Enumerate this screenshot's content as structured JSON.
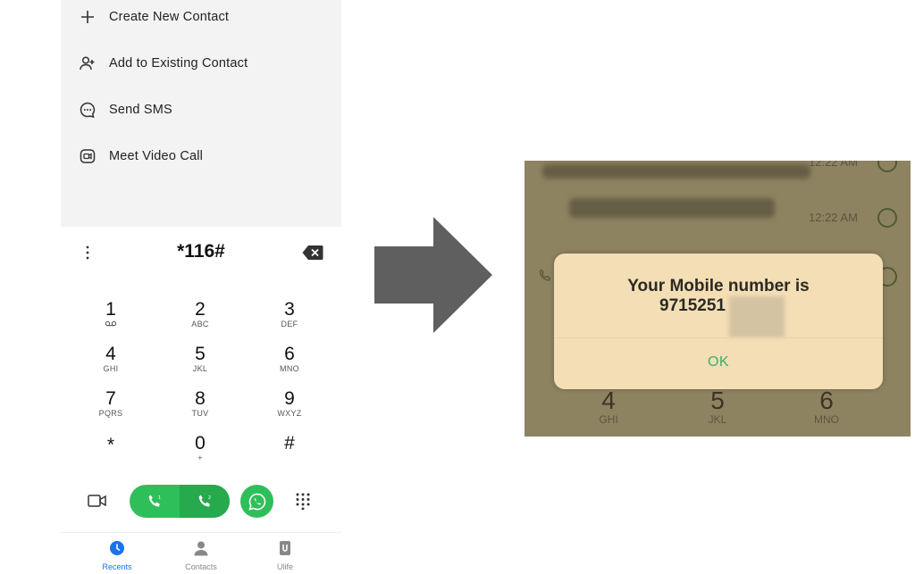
{
  "menu": {
    "items": [
      {
        "label": "Create New Contact",
        "icon": "plus-icon"
      },
      {
        "label": "Add to Existing Contact",
        "icon": "add-person-icon"
      },
      {
        "label": "Send SMS",
        "icon": "sms-icon"
      },
      {
        "label": "Meet Video Call",
        "icon": "meet-video-icon"
      }
    ]
  },
  "dialer": {
    "input_value": "*116#",
    "keys": [
      {
        "digit": "1",
        "letters": "voicemail-icon"
      },
      {
        "digit": "2",
        "letters": "ABC"
      },
      {
        "digit": "3",
        "letters": "DEF"
      },
      {
        "digit": "4",
        "letters": "GHI"
      },
      {
        "digit": "5",
        "letters": "JKL"
      },
      {
        "digit": "6",
        "letters": "MNO"
      },
      {
        "digit": "7",
        "letters": "PQRS"
      },
      {
        "digit": "8",
        "letters": "TUV"
      },
      {
        "digit": "9",
        "letters": "WXYZ"
      },
      {
        "digit": "*",
        "letters": ""
      },
      {
        "digit": "0",
        "letters": "+"
      },
      {
        "digit": "#",
        "letters": ""
      }
    ],
    "sim1_label": "1",
    "sim2_label": "2"
  },
  "tabs": [
    {
      "label": "Recents",
      "active": true
    },
    {
      "label": "Contacts",
      "active": false
    },
    {
      "label": "Ulife",
      "active": false
    }
  ],
  "result_screen": {
    "message": "Your Mobile number is",
    "number_partial": "9715251",
    "ok_label": "OK",
    "times": [
      "12:22 AM",
      "12:22 AM"
    ],
    "keys": [
      {
        "digit": "4",
        "letters": "GHI"
      },
      {
        "digit": "5",
        "letters": "JKL"
      },
      {
        "digit": "6",
        "letters": "MNO"
      }
    ]
  },
  "colors": {
    "call_green": "#2fbf5a",
    "active_tab": "#1a73e8",
    "dialog_bg": "#f3deb6",
    "ok_text": "#3eae6a",
    "arrow": "#5f5f5f"
  }
}
